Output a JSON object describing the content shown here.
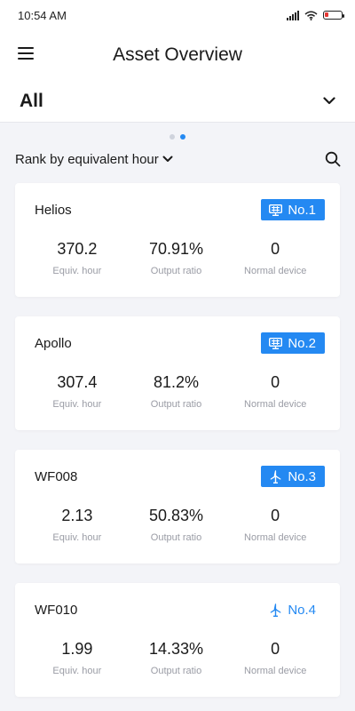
{
  "status": {
    "time": "10:54 AM"
  },
  "header": {
    "title": "Asset Overview"
  },
  "filter": {
    "value": "All"
  },
  "carousel": {
    "dots": 2,
    "active": 1
  },
  "rank": {
    "label": "Rank by equivalent hour"
  },
  "labels": {
    "equiv_hour": "Equiv. hour",
    "output_ratio": "Output ratio",
    "normal_device": "Normal device"
  },
  "assets": [
    {
      "name": "Helios",
      "rank": "No.1",
      "icon": "solar-panel-icon",
      "badge_style": "filled",
      "equiv_hour": "370.2",
      "output_ratio": "70.91%",
      "normal_device": "0"
    },
    {
      "name": "Apollo",
      "rank": "No.2",
      "icon": "solar-panel-icon",
      "badge_style": "filled",
      "equiv_hour": "307.4",
      "output_ratio": "81.2%",
      "normal_device": "0"
    },
    {
      "name": "WF008",
      "rank": "No.3",
      "icon": "wind-turbine-icon",
      "badge_style": "filled",
      "equiv_hour": "2.13",
      "output_ratio": "50.83%",
      "normal_device": "0"
    },
    {
      "name": "WF010",
      "rank": "No.4",
      "icon": "wind-turbine-icon",
      "badge_style": "plain",
      "equiv_hour": "1.99",
      "output_ratio": "14.33%",
      "normal_device": "0"
    }
  ],
  "colors": {
    "accent": "#2489f2",
    "background": "#f3f4f8",
    "label": "#9a9ca5"
  }
}
